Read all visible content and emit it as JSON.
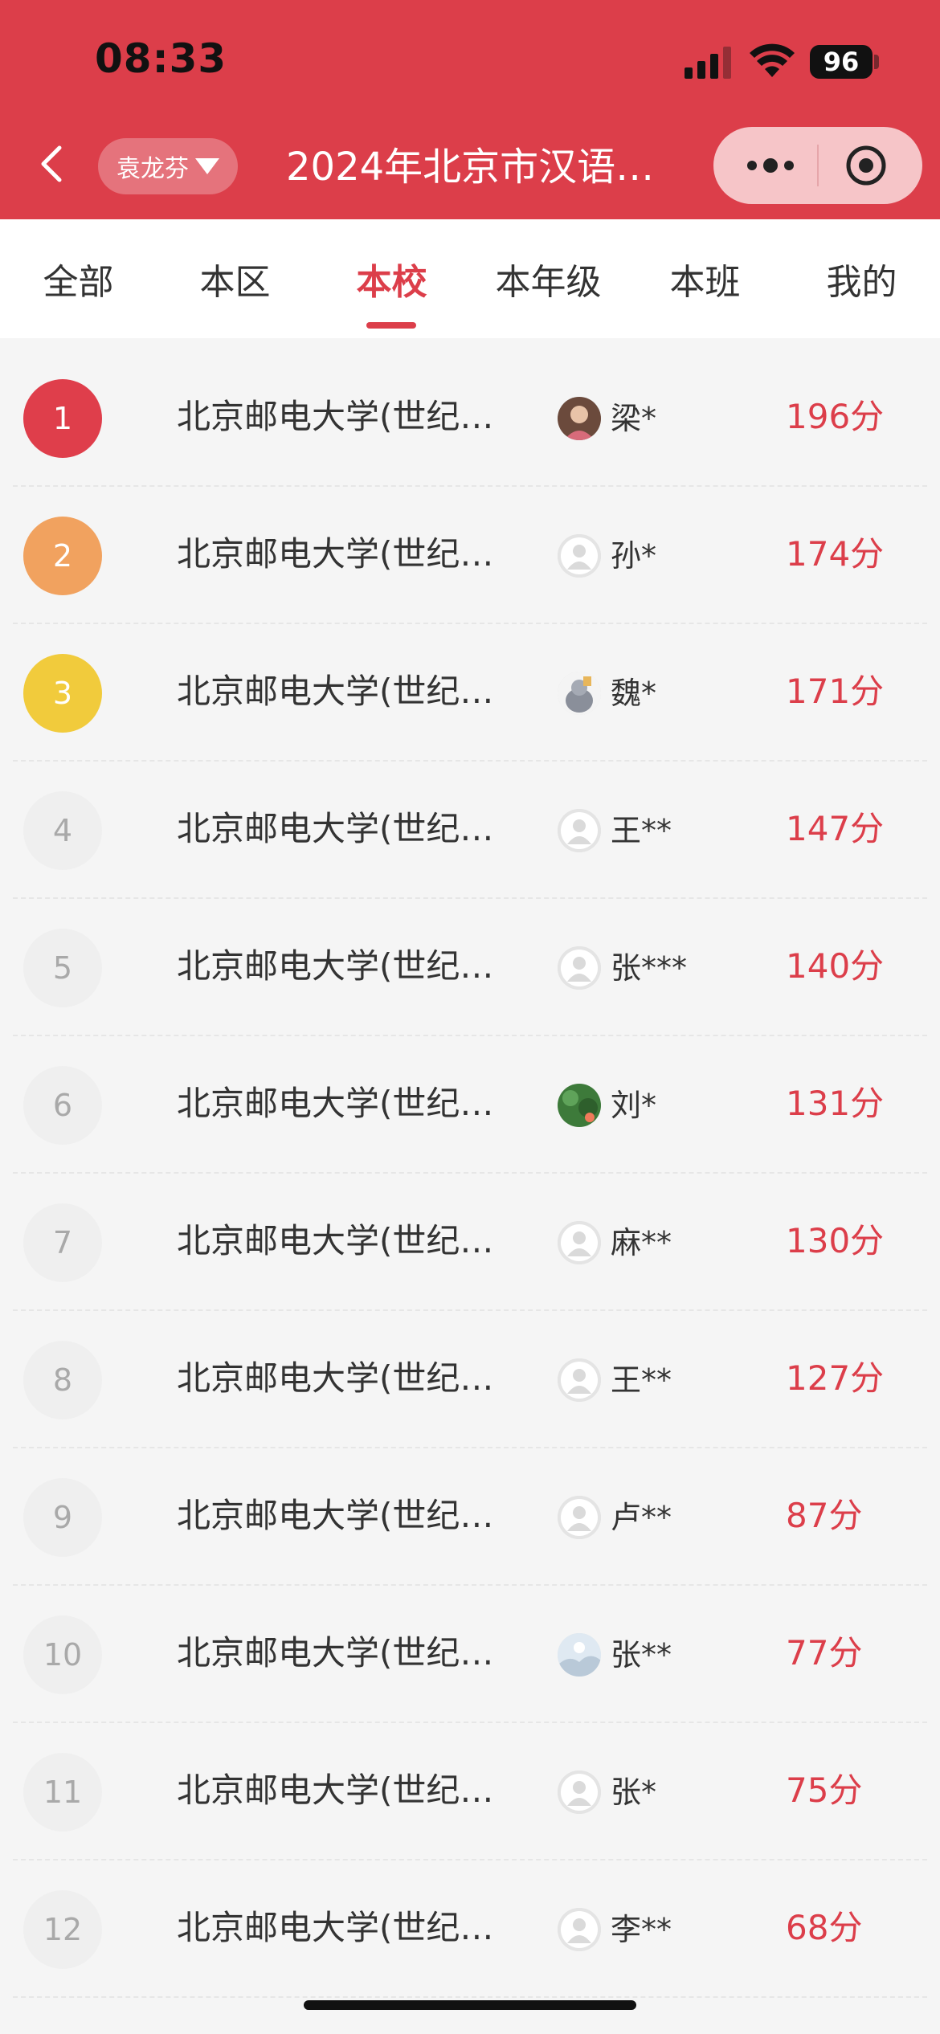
{
  "status_bar": {
    "time": "08:33",
    "battery": "96"
  },
  "header": {
    "user_name": "袁龙芬",
    "title": "2024年北京市汉语…"
  },
  "tabs": [
    {
      "label": "全部"
    },
    {
      "label": "本区"
    },
    {
      "label": "本校"
    },
    {
      "label": "本年级"
    },
    {
      "label": "本班"
    },
    {
      "label": "我的"
    }
  ],
  "active_tab": "本校",
  "colors": {
    "brand": "#dc3e4a",
    "rank1": "#df3e4b",
    "rank2": "#f1a25f",
    "rank3": "#f1cb3c"
  },
  "ranking": [
    {
      "rank": "1",
      "school": "北京邮电大学(世纪…",
      "name": "梁*",
      "score": "196分",
      "avatar": "photo-avatar"
    },
    {
      "rank": "2",
      "school": "北京邮电大学(世纪…",
      "name": "孙*",
      "score": "174分",
      "avatar": "default-avatar"
    },
    {
      "rank": "3",
      "school": "北京邮电大学(世纪…",
      "name": "魏*",
      "score": "171分",
      "avatar": "cartoon-avatar"
    },
    {
      "rank": "4",
      "school": "北京邮电大学(世纪…",
      "name": "王**",
      "score": "147分",
      "avatar": "default-avatar"
    },
    {
      "rank": "5",
      "school": "北京邮电大学(世纪…",
      "name": "张***",
      "score": "140分",
      "avatar": "default-avatar"
    },
    {
      "rank": "6",
      "school": "北京邮电大学(世纪…",
      "name": "刘*",
      "score": "131分",
      "avatar": "green-photo-avatar"
    },
    {
      "rank": "7",
      "school": "北京邮电大学(世纪…",
      "name": "麻**",
      "score": "130分",
      "avatar": "default-avatar"
    },
    {
      "rank": "8",
      "school": "北京邮电大学(世纪…",
      "name": "王**",
      "score": "127分",
      "avatar": "default-avatar"
    },
    {
      "rank": "9",
      "school": "北京邮电大学(世纪…",
      "name": "卢**",
      "score": "87分",
      "avatar": "default-avatar"
    },
    {
      "rank": "10",
      "school": "北京邮电大学(世纪…",
      "name": "张**",
      "score": "77分",
      "avatar": "landscape-avatar"
    },
    {
      "rank": "11",
      "school": "北京邮电大学(世纪…",
      "name": "张*",
      "score": "75分",
      "avatar": "default-avatar"
    },
    {
      "rank": "12",
      "school": "北京邮电大学(世纪…",
      "name": "李**",
      "score": "68分",
      "avatar": "default-avatar"
    }
  ]
}
